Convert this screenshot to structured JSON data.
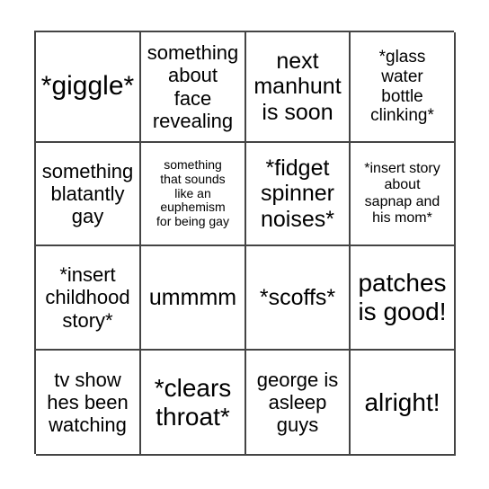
{
  "card": {
    "type": "bingo",
    "rows": 4,
    "columns": 4,
    "background_color": "#ffffff",
    "border_color": "#444444",
    "text_color": "#000000",
    "cells": [
      {
        "text": "*giggle*",
        "size": "fs-xxl"
      },
      {
        "text": "something\nabout\nface\nrevealing",
        "size": "fs-md"
      },
      {
        "text": "next\nmanhunt\nis soon",
        "size": "fs-lg"
      },
      {
        "text": "*glass\nwater\nbottle\nclinking*",
        "size": "fs-sm"
      },
      {
        "text": "something\nblatantly\ngay",
        "size": "fs-md"
      },
      {
        "text": "something\nthat sounds\nlike an\neuphemism\nfor being gay",
        "size": "fs-xxs"
      },
      {
        "text": "*fidget\nspinner\nnoises*",
        "size": "fs-lg"
      },
      {
        "text": "*insert story\nabout\nsapnap and\nhis mom*",
        "size": "fs-xs"
      },
      {
        "text": "*insert\nchildhood\nstory*",
        "size": "fs-md"
      },
      {
        "text": "ummmm",
        "size": "fs-lg"
      },
      {
        "text": "*scoffs*",
        "size": "fs-lg"
      },
      {
        "text": "patches\nis good!",
        "size": "fs-xl"
      },
      {
        "text": "tv show\nhes been\nwatching",
        "size": "fs-md"
      },
      {
        "text": "*clears\nthroat*",
        "size": "fs-xl"
      },
      {
        "text": "george is\nasleep\nguys",
        "size": "fs-md"
      },
      {
        "text": "alright!",
        "size": "fs-xl"
      }
    ]
  }
}
